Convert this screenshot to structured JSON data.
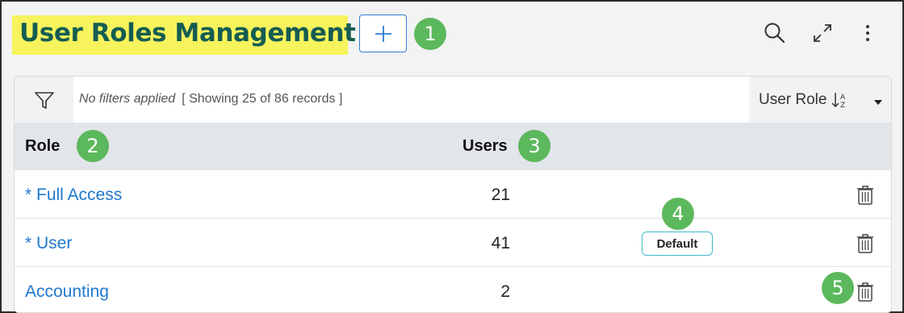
{
  "header": {
    "title": "User Roles Management",
    "add_button_icon": "plus-icon",
    "search_icon": "search-icon",
    "expand_icon": "expand-icon",
    "more_icon": "more-vertical-icon"
  },
  "callouts": [
    "1",
    "2",
    "3",
    "4",
    "5"
  ],
  "filter_bar": {
    "filter_icon": "filter-icon",
    "no_filters": "No filters applied",
    "showing": "[ Showing 25 of 86 records ]",
    "sort_label": "User Role",
    "sort_icon": "sort-alpha-icon",
    "dropdown_icon": "caret-down-icon"
  },
  "table": {
    "columns": [
      "Role",
      "Users"
    ],
    "rows": [
      {
        "role": "* Full Access",
        "users": "21",
        "badge": ""
      },
      {
        "role": "* User",
        "users": "41",
        "badge": "Default"
      },
      {
        "role": "Accounting",
        "users": "2",
        "badge": ""
      }
    ]
  },
  "colors": {
    "title_highlight": "#f7f35c",
    "title_text": "#155d52",
    "link": "#1f78d1",
    "callout": "#5cb85c",
    "badge_border": "#3fb9c9"
  }
}
